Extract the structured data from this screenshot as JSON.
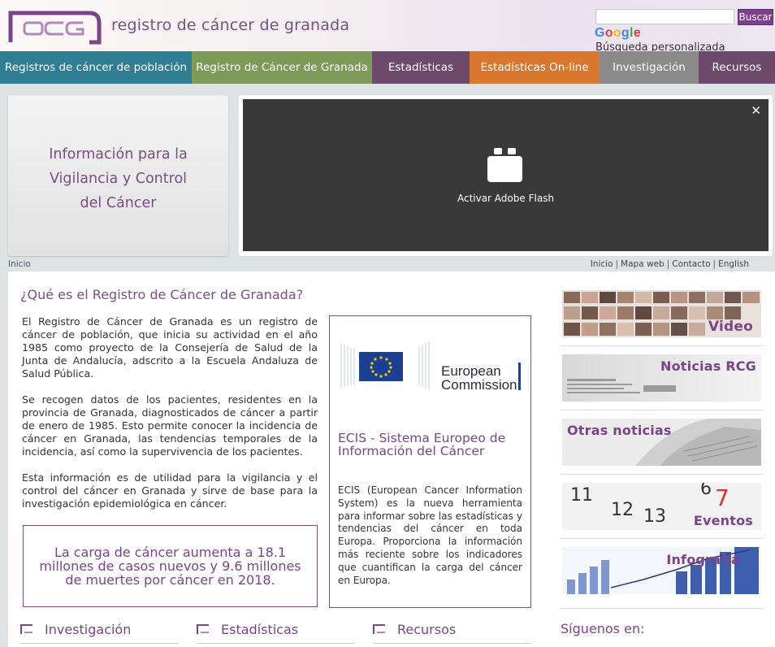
{
  "header": {
    "site_title": "registro de cáncer de granada",
    "search_button": "Buscar",
    "search_placeholder": "",
    "google_text": "Google",
    "google_sub": "Búsqueda personalizada"
  },
  "nav": [
    {
      "label": "Registros de cáncer de población",
      "color": "#2f7e93"
    },
    {
      "label": "Registro de Cáncer de Granada",
      "color": "#7d9a58"
    },
    {
      "label": "Estadísticas",
      "color": "#6d4a6b"
    },
    {
      "label": "Estadísticas On-line",
      "color": "#d8772d"
    },
    {
      "label": "Investigación",
      "color": "#8a8a8a"
    },
    {
      "label": "Recursos",
      "color": "#6d4a6b"
    }
  ],
  "hero": {
    "promo_line1": "Información para la",
    "promo_line2": "Vigilancia y Control",
    "promo_line3": "del Cáncer",
    "flash_label": "Activar Adobe Flash",
    "flash_close": "✕"
  },
  "breadcrumb": "Inicio",
  "utility": [
    "Inicio",
    "Mapa web",
    "Contacto",
    "English"
  ],
  "utility_sep": "|",
  "main": {
    "heading": "¿Qué es el Registro de Cáncer de Granada?",
    "paragraphs": [
      "El Registro de Cáncer de Granada es un registro de cáncer de población, que inicia su actividad en el año 1985 como proyecto de la Consejería de Salud de la Junta de Andalucía, adscrito a la Escuela Andaluza de Salud Pública.",
      "Se recogen datos de los pacientes, residentes en la provincia de Granada, diagnosticados de cáncer a partir de enero de 1985. Esto permite conocer la incidencia de cáncer en Granada, las tendencias temporales de la incidencia, así como la supervivencia de los pacientes.",
      "Esta información es de utilidad para la vigilancia y el control del cáncer en Granada y sirve de base para la investigación epidemiológica en cáncer."
    ],
    "callout": "La carga de cáncer aumenta a 18.1 millones de casos nuevos y 9.6 millones de muertes por cáncer en 2018."
  },
  "ecis": {
    "logo_line1": "European",
    "logo_line2": "Commission",
    "title": "ECIS - Sistema Europeo de Información del Cáncer",
    "body": "ECIS (European Cancer Information System) es la nueva herramienta para informar sobre las estadísticas y tendencias del cáncer en toda Europa. Proporciona la información más reciente sobre los indicadores que cuantifican la carga del cáncer en Europa."
  },
  "sidebar": {
    "tiles": [
      "Video",
      "Noticias RCG",
      "Otras noticias",
      "Eventos",
      "Infografía"
    ],
    "follow": "Síguenos en:"
  },
  "bottom": [
    "Investigación",
    "Estadísticas",
    "Recursos"
  ]
}
